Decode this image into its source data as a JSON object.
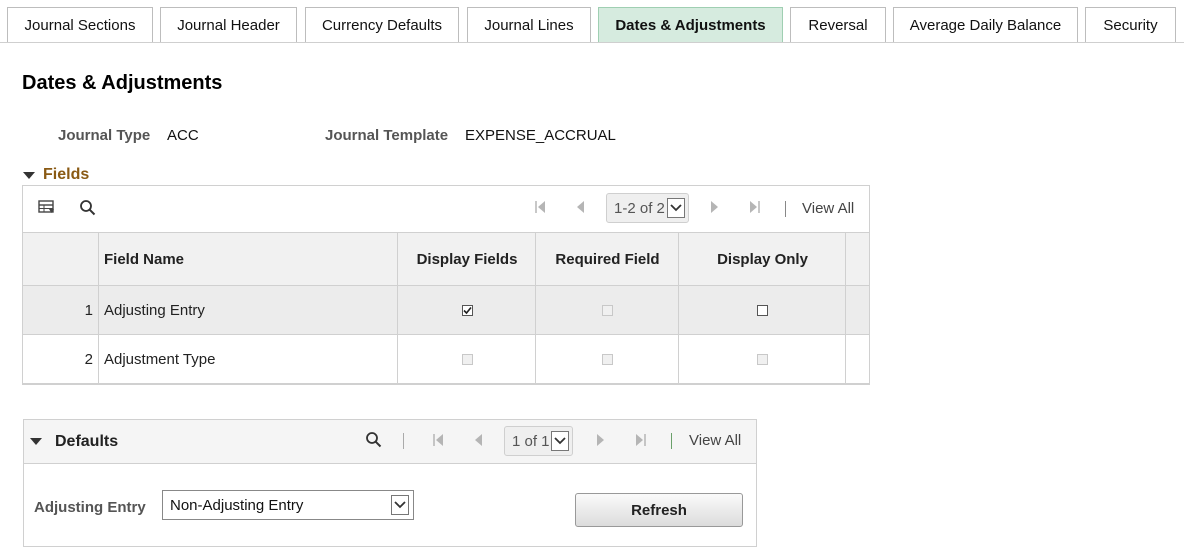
{
  "tabs": [
    {
      "label": "Journal Sections"
    },
    {
      "label": "Journal Header"
    },
    {
      "label": "Currency Defaults"
    },
    {
      "label": "Journal Lines"
    },
    {
      "label": "Dates & Adjustments"
    },
    {
      "label": "Reversal"
    },
    {
      "label": "Average Daily Balance"
    },
    {
      "label": "Security"
    }
  ],
  "page": {
    "title": "Dates & Adjustments"
  },
  "header": {
    "journal_type_label": "Journal Type",
    "journal_type_value": "ACC",
    "journal_template_label": "Journal Template",
    "journal_template_value": "EXPENSE_ACCRUAL"
  },
  "fields": {
    "section_label": "Fields",
    "pager_text": "1-2 of 2",
    "view_all": "View All",
    "columns": {
      "field_name": "Field Name",
      "display_fields": "Display Fields",
      "required_field": "Required Field",
      "display_only": "Display Only"
    },
    "rows": [
      {
        "num": "1",
        "name": "Adjusting Entry",
        "display_fields": true,
        "required_field": false,
        "display_only": false
      },
      {
        "num": "2",
        "name": "Adjustment Type",
        "display_fields": false,
        "required_field": false,
        "display_only": false
      }
    ]
  },
  "defaults": {
    "section_label": "Defaults",
    "pager_text": "1 of 1",
    "view_all": "View All",
    "adjusting_entry_label": "Adjusting Entry",
    "adjusting_entry_value": "Non-Adjusting Entry",
    "refresh_label": "Refresh"
  }
}
